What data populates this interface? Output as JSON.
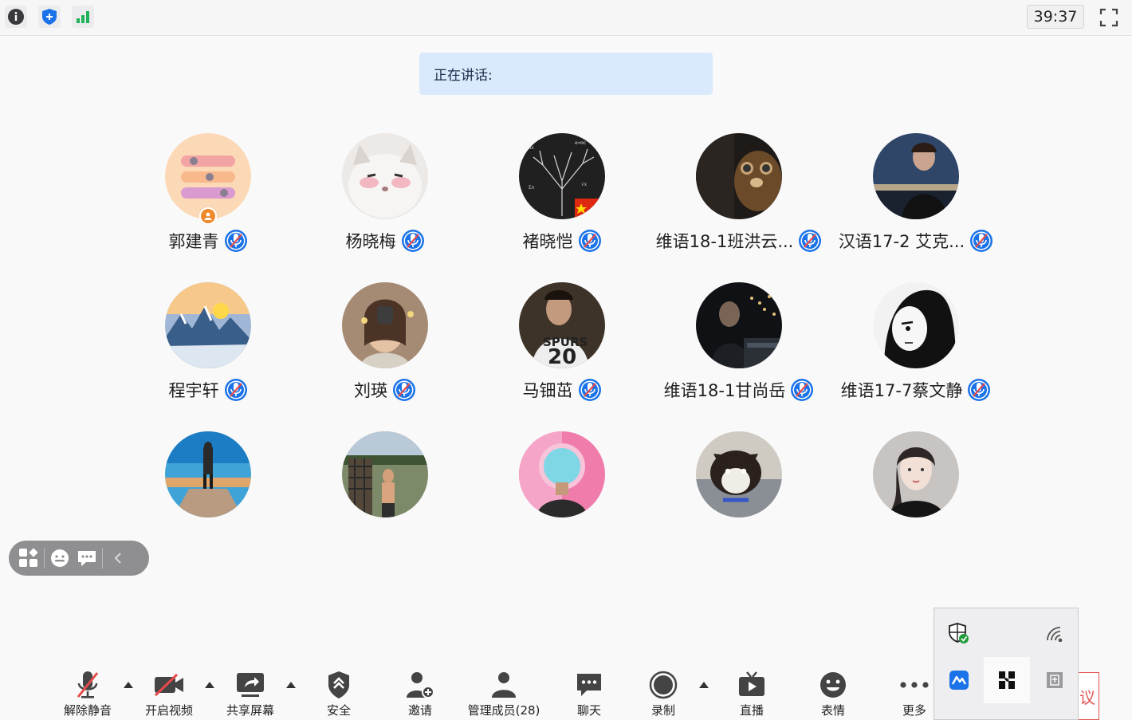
{
  "topbar": {
    "info_icon": "info-icon",
    "shield_icon": "shield-icon",
    "signal_icon": "signal-bars-icon",
    "timer": "39:37",
    "fullscreen_icon": "fullscreen-icon"
  },
  "speaking": {
    "label": "正在讲话:"
  },
  "participants": [
    {
      "name": "郭建青",
      "muted": true,
      "host": true
    },
    {
      "name": "杨晓梅",
      "muted": true
    },
    {
      "name": "褚晓恺",
      "muted": true
    },
    {
      "name": "维语18-1班洪云...",
      "muted": true
    },
    {
      "name": "汉语17-2 艾克...",
      "muted": true
    },
    {
      "name": "程宇轩",
      "muted": true
    },
    {
      "name": "刘瑛",
      "muted": true
    },
    {
      "name": "马钿茁",
      "muted": true
    },
    {
      "name": "维语18-1甘尚岳",
      "muted": true
    },
    {
      "name": "维语17-7蔡文静",
      "muted": true
    },
    {
      "name": ""
    },
    {
      "name": ""
    },
    {
      "name": ""
    },
    {
      "name": ""
    },
    {
      "name": ""
    }
  ],
  "floatbar": {
    "icons": [
      "layout-grid-icon",
      "emoji-icon",
      "chat-icon",
      "collapse-chevron-icon"
    ]
  },
  "toolbar": {
    "unmute": "解除静音",
    "start_video": "开启视频",
    "share_screen": "共享屏幕",
    "security": "安全",
    "invite": "邀请",
    "manage": "管理成员(28)",
    "chat": "聊天",
    "record": "录制",
    "live": "直播",
    "reaction": "表情",
    "more": "更多"
  },
  "leave": {
    "partial_label": "议"
  },
  "colors": {
    "accent": "#1a73e8",
    "mute_red": "#e64a4a",
    "speaking_bg": "#dbe9fc"
  }
}
